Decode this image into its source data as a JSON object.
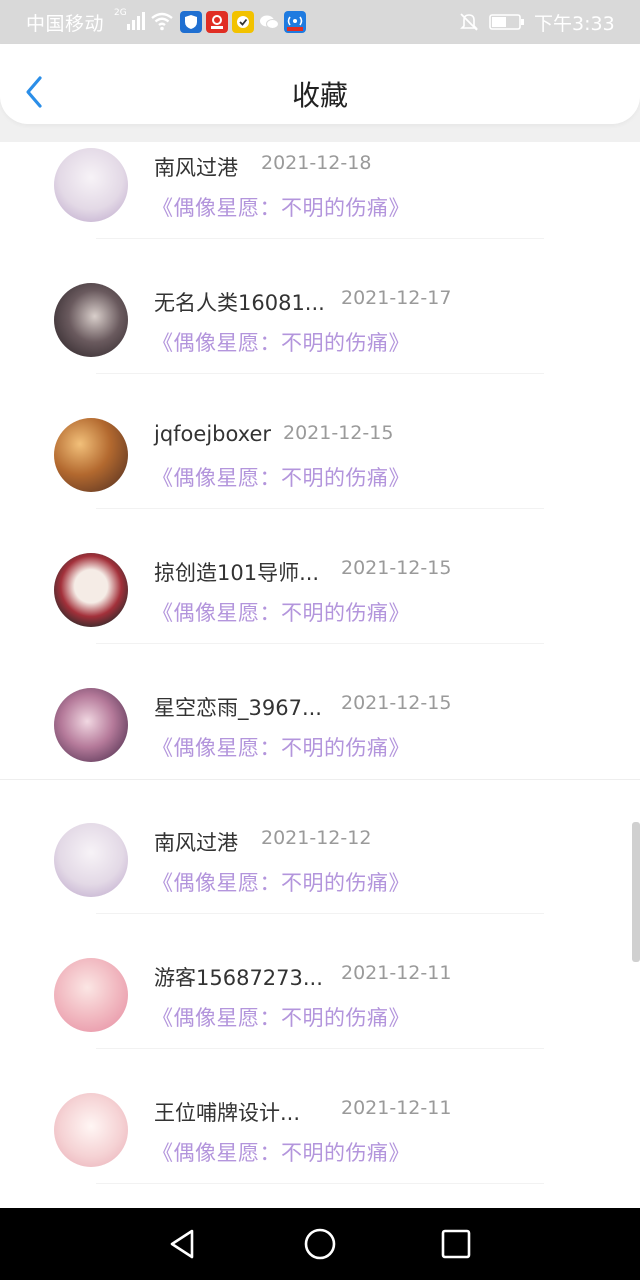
{
  "status_bar": {
    "carrier": "中国移动",
    "network": "2G",
    "time": "下午3:33",
    "app_icons": [
      "shield-app-icon",
      "pinduoduo-app-icon",
      "qq-app-icon",
      "wechat-app-icon",
      "hotspot-app-icon"
    ]
  },
  "header": {
    "title": "收藏",
    "back_icon": "chevron-left-icon"
  },
  "favorites": [
    {
      "name": "南风过港",
      "date": "2021-12-18",
      "book": "《偶像星愿：不明的伤痛》",
      "avatar_color": "#e8e2ea"
    },
    {
      "name": "无名人类16081...",
      "date": "2021-12-17",
      "book": "《偶像星愿：不明的伤痛》",
      "avatar_color": "#3b3236"
    },
    {
      "name": "jqfoejboxer",
      "date": "2021-12-15",
      "book": "《偶像星愿：不明的伤痛》",
      "avatar_color": "#9a5a33"
    },
    {
      "name": "掠创造101导师...",
      "date": "2021-12-15",
      "book": "《偶像星愿：不明的伤痛》",
      "avatar_color": "#5a2a2e"
    },
    {
      "name": "星空恋雨_3967...",
      "date": "2021-12-15",
      "book": "《偶像星愿：不明的伤痛》",
      "avatar_color": "#8a5a7c"
    },
    {
      "name": "南风过港",
      "date": "2021-12-12",
      "book": "《偶像星愿：不明的伤痛》",
      "avatar_color": "#e8e2ea"
    },
    {
      "name": "游客15687273...",
      "date": "2021-12-11",
      "book": "《偶像星愿：不明的伤痛》",
      "avatar_color": "#f4c4c9"
    },
    {
      "name": "王位哺牌设计...",
      "date": "2021-12-11",
      "book": "《偶像星愿：不明的伤痛》",
      "avatar_color": "#f6dcdc"
    }
  ],
  "nav_bar": {
    "back": "triangle-back-icon",
    "home": "circle-home-icon",
    "recents": "square-recents-icon"
  }
}
